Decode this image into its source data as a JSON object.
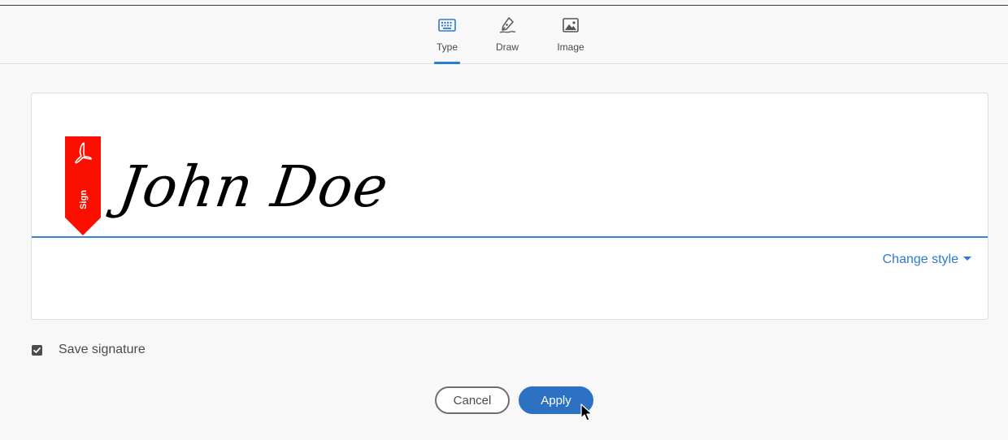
{
  "tabs": [
    {
      "label": "Type",
      "icon": "keyboard-icon",
      "active": true
    },
    {
      "label": "Draw",
      "icon": "pen-draw-icon",
      "active": false
    },
    {
      "label": "Image",
      "icon": "image-icon",
      "active": false
    }
  ],
  "signature": {
    "text": "John Doe",
    "ribbon_label": "Sign",
    "change_style_label": "Change style"
  },
  "save_signature": {
    "label": "Save signature",
    "checked": true
  },
  "buttons": {
    "cancel_label": "Cancel",
    "apply_label": "Apply"
  },
  "colors": {
    "accent": "#2c7ad1",
    "apply_bg": "#2c71c4",
    "ribbon": "#fa0f00",
    "baseline": "#3d82d6"
  }
}
